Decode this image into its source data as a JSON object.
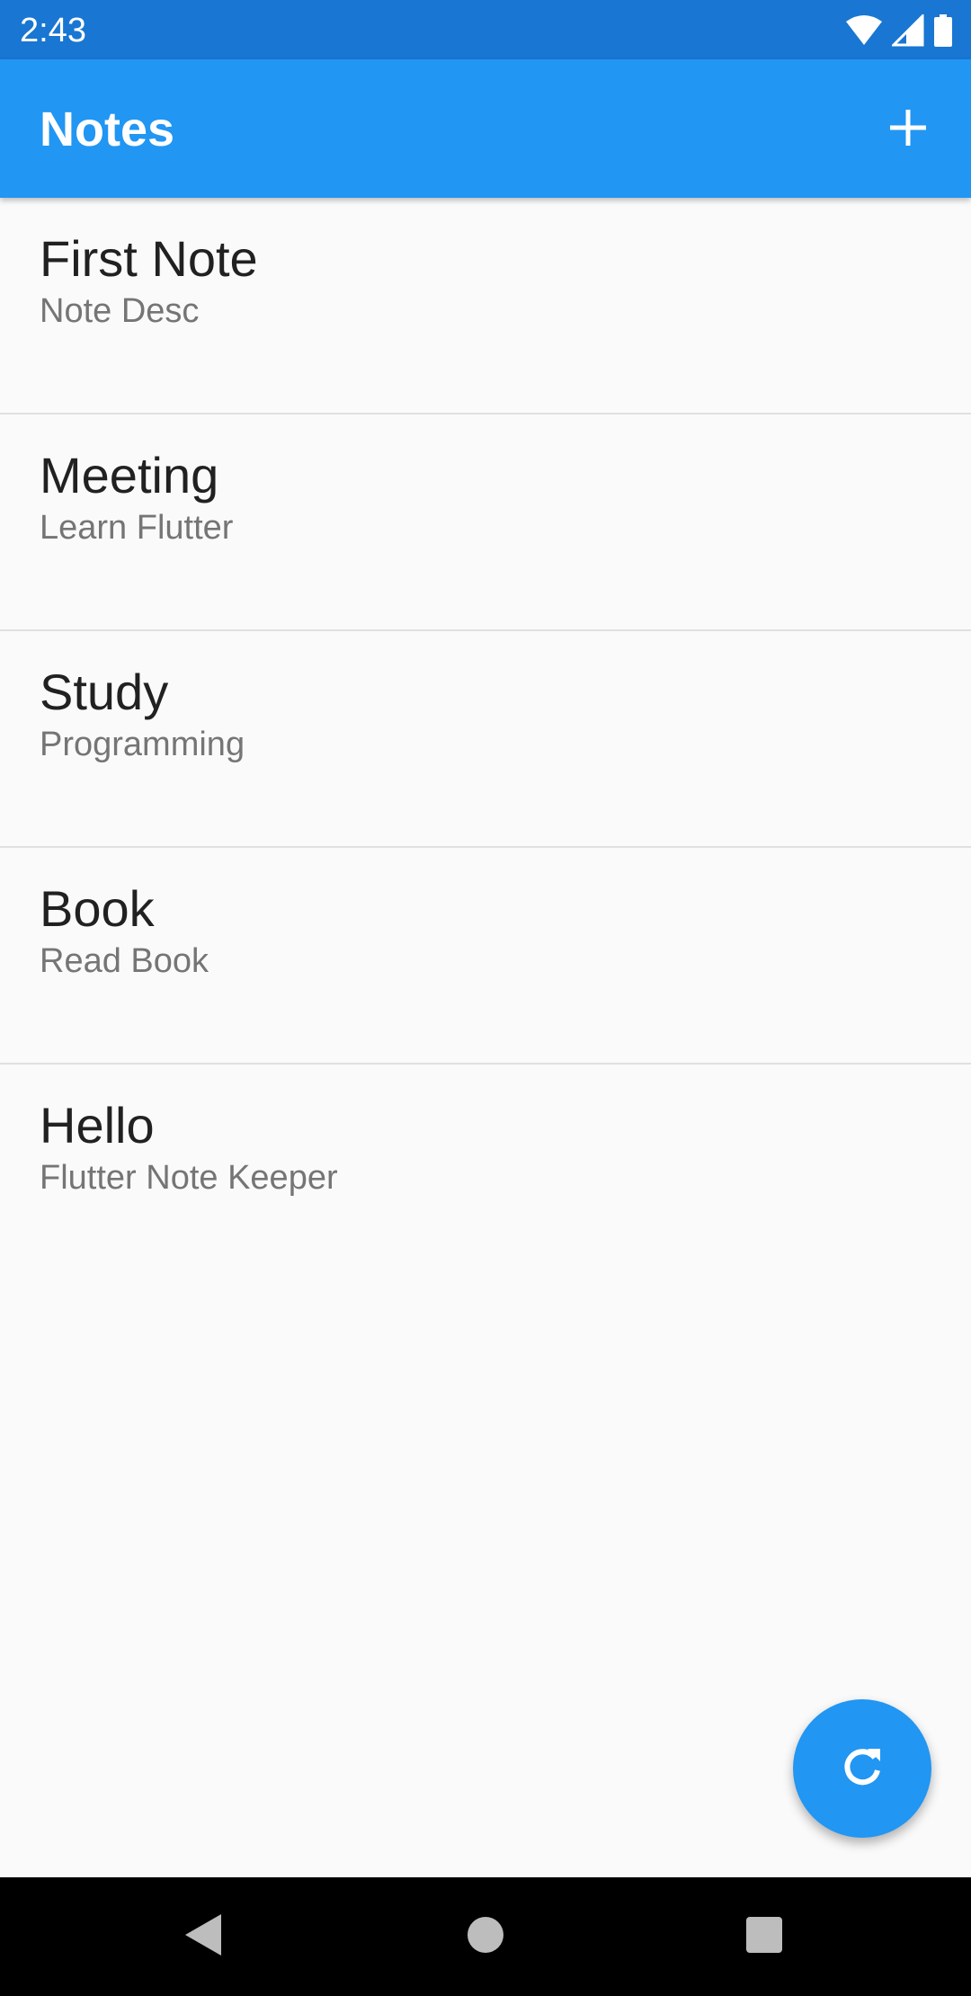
{
  "status_bar": {
    "time": "2:43",
    "icons": [
      "wifi-icon",
      "cell-signal-icon",
      "battery-icon"
    ]
  },
  "app_bar": {
    "title": "Notes",
    "action_icon": "plus-icon",
    "color": "#2196f3"
  },
  "notes": [
    {
      "title": "First Note",
      "description": "Note Desc"
    },
    {
      "title": "Meeting",
      "description": "Learn Flutter"
    },
    {
      "title": "Study",
      "description": "Programming"
    },
    {
      "title": "Book",
      "description": "Read Book"
    },
    {
      "title": "Hello",
      "description": "Flutter Note Keeper"
    }
  ],
  "fab": {
    "icon": "refresh-icon",
    "color": "#2196f3"
  },
  "navigation_bar": {
    "buttons": [
      "back-icon",
      "home-icon",
      "recents-icon"
    ]
  },
  "colors": {
    "status_bar": "#1976d2",
    "background": "#fafafa",
    "title_text": "#212121",
    "description_text": "#757575"
  }
}
